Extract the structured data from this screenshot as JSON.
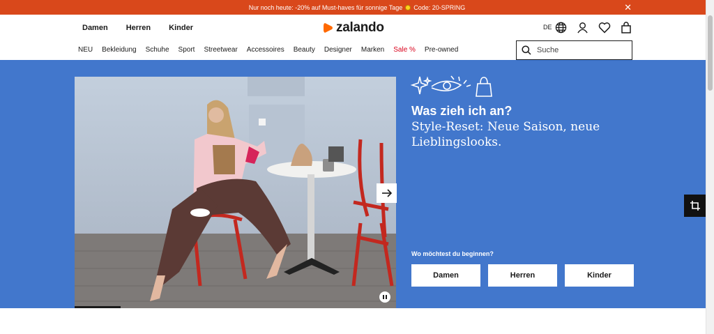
{
  "promo": {
    "text_before": "Nur noch heute: -20% auf Must-haves für sonnige Tage",
    "text_after": "Code: 20-SPRING",
    "close_icon": "close-icon"
  },
  "header": {
    "gender_tabs": [
      "Damen",
      "Herren",
      "Kinder"
    ],
    "logo_text": "zalando",
    "language": "DE",
    "icons": [
      "globe-icon",
      "user-icon",
      "heart-icon",
      "bag-icon"
    ]
  },
  "categories": [
    {
      "label": "NEU"
    },
    {
      "label": "Bekleidung"
    },
    {
      "label": "Schuhe"
    },
    {
      "label": "Sport"
    },
    {
      "label": "Streetwear"
    },
    {
      "label": "Accessoires"
    },
    {
      "label": "Beauty"
    },
    {
      "label": "Designer"
    },
    {
      "label": "Marken"
    },
    {
      "label": "Sale %"
    },
    {
      "label": "Pre-owned"
    }
  ],
  "search": {
    "placeholder": "Suche",
    "value": ""
  },
  "hero": {
    "title": "Was zieh ich an?",
    "subtitle": "Style-Reset: Neue Saison, neue Lieblingslooks.",
    "question": "Wo möchtest du beginnen?",
    "buttons": [
      "Damen",
      "Herren",
      "Kinder"
    ],
    "background_color": "#4277cc"
  },
  "colors": {
    "promo": "#d9481b",
    "accent": "#ff6900",
    "sale": "#d9001b"
  }
}
